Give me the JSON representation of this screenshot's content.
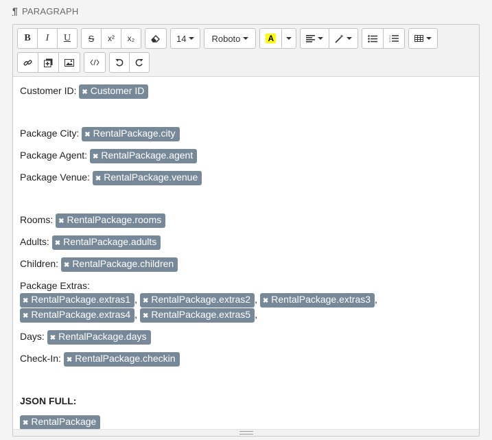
{
  "header": {
    "icon": "pilcrow-icon",
    "title": "PARAGRAPH"
  },
  "toolbar": {
    "bold": "B",
    "italic": "I",
    "underline": "U",
    "strikethrough": "S",
    "superscript": "x²",
    "subscript": "x₂",
    "font_size": "14",
    "font_family": "Roboto",
    "highlight": "A"
  },
  "content": {
    "customer_id_label": "Customer ID:",
    "customer_id_tag": "Customer ID",
    "city_label": "Package City:",
    "city_tag": "RentalPackage.city",
    "agent_label": "Package Agent:",
    "agent_tag": "RentalPackage.agent",
    "venue_label": "Package Venue:",
    "venue_tag": "RentalPackage.venue",
    "rooms_label": "Rooms:",
    "rooms_tag": "RentalPackage.rooms",
    "adults_label": "Adults:",
    "adults_tag": "RentalPackage.adults",
    "children_label": "Children:",
    "children_tag": "RentalPackage.children",
    "extras_label": "Package Extras:",
    "extras_tags": [
      "RentalPackage.extras1",
      "RentalPackage.extras2",
      "RentalPackage.extras3",
      "RentalPackage.extras4",
      "RentalPackage.extras5"
    ],
    "separator": ",",
    "days_label": "Days:",
    "days_tag": "RentalPackage.days",
    "checkin_label": "Check-In:",
    "checkin_tag": "RentalPackage.checkin",
    "json_full_label": "JSON FULL:",
    "json_full_tag": "RentalPackage"
  },
  "colors": {
    "tag_bg": "#778899",
    "highlight": "#ffff00"
  }
}
